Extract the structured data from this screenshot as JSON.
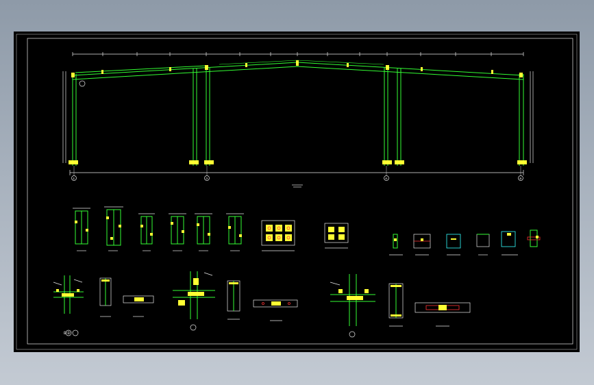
{
  "drawing": {
    "colors": {
      "background": "#000000",
      "structure": "#33ff33",
      "dimension": "#e8e8e8",
      "plate": "#ffff33",
      "bolt": "#ff3333",
      "accent": "#33ffff"
    },
    "grid_markers": [
      "①",
      "③",
      "④",
      "⑧"
    ],
    "detail_captions": [
      "①②"
    ]
  }
}
